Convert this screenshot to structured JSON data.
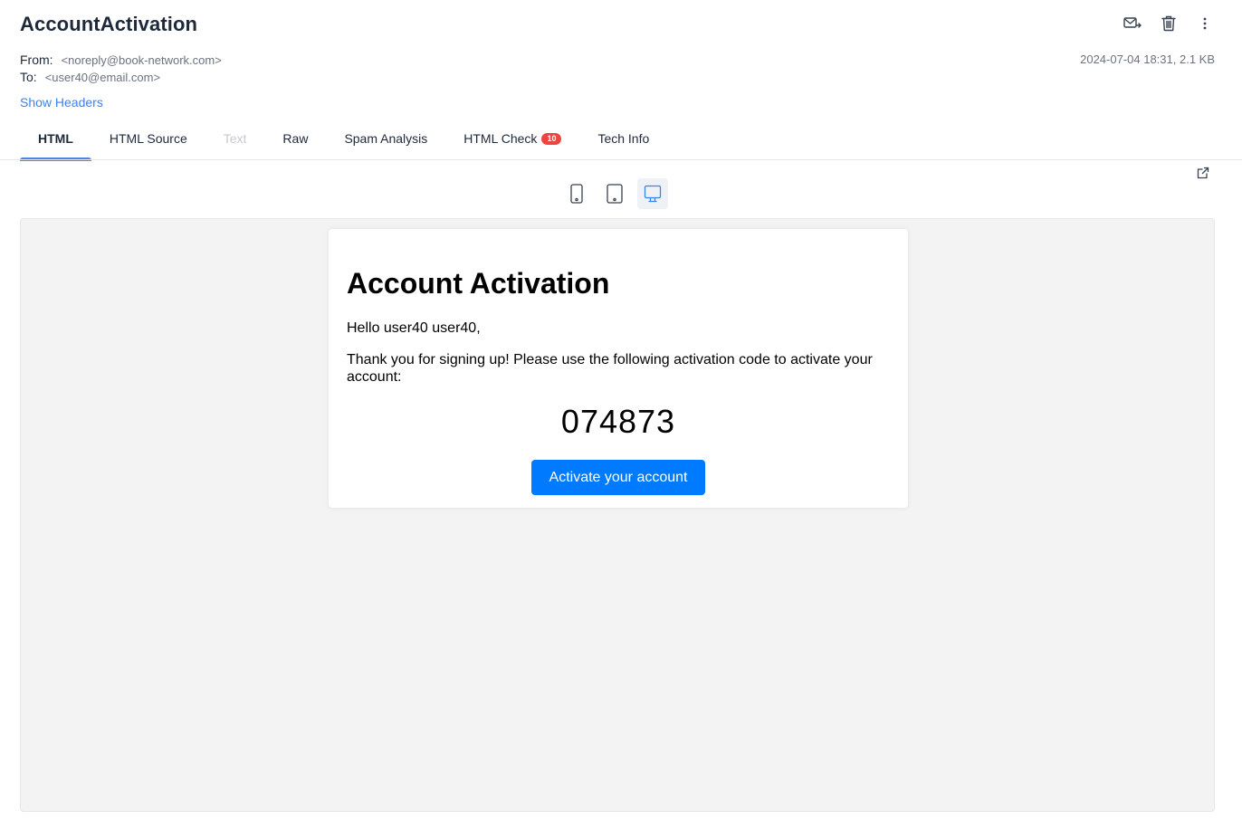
{
  "message": {
    "subject": "AccountActivation",
    "from_label": "From:",
    "from_value": "<noreply@book-network.com>",
    "to_label": "To:",
    "to_value": "<user40@email.com>",
    "date_size": "2024-07-04 18:31, 2.1 KB",
    "show_headers": "Show Headers"
  },
  "toolbar": {
    "icons": [
      "mail-forward-icon",
      "trash-icon",
      "more-vertical-icon"
    ]
  },
  "tabs": [
    {
      "label": "HTML",
      "state": "active"
    },
    {
      "label": "HTML Source",
      "state": "normal"
    },
    {
      "label": "Text",
      "state": "disabled"
    },
    {
      "label": "Raw",
      "state": "normal"
    },
    {
      "label": "Spam Analysis",
      "state": "normal"
    },
    {
      "label": "HTML Check",
      "state": "normal",
      "badge": "10"
    },
    {
      "label": "Tech Info",
      "state": "normal"
    }
  ],
  "device_toggle": {
    "options": [
      "phone-icon",
      "tablet-icon",
      "desktop-icon"
    ],
    "selected": "desktop-icon"
  },
  "email_body": {
    "heading": "Account Activation",
    "greeting": "Hello user40 user40,",
    "intro": "Thank you for signing up! Please use the following activation code to activate your account:",
    "code": "074873",
    "button_label": "Activate your account"
  },
  "colors": {
    "accent": "#4f83e6",
    "link": "#3b82f6",
    "badge": "#ef4444",
    "email_button": "#007bff",
    "preview_bg": "#f3f3f3"
  }
}
